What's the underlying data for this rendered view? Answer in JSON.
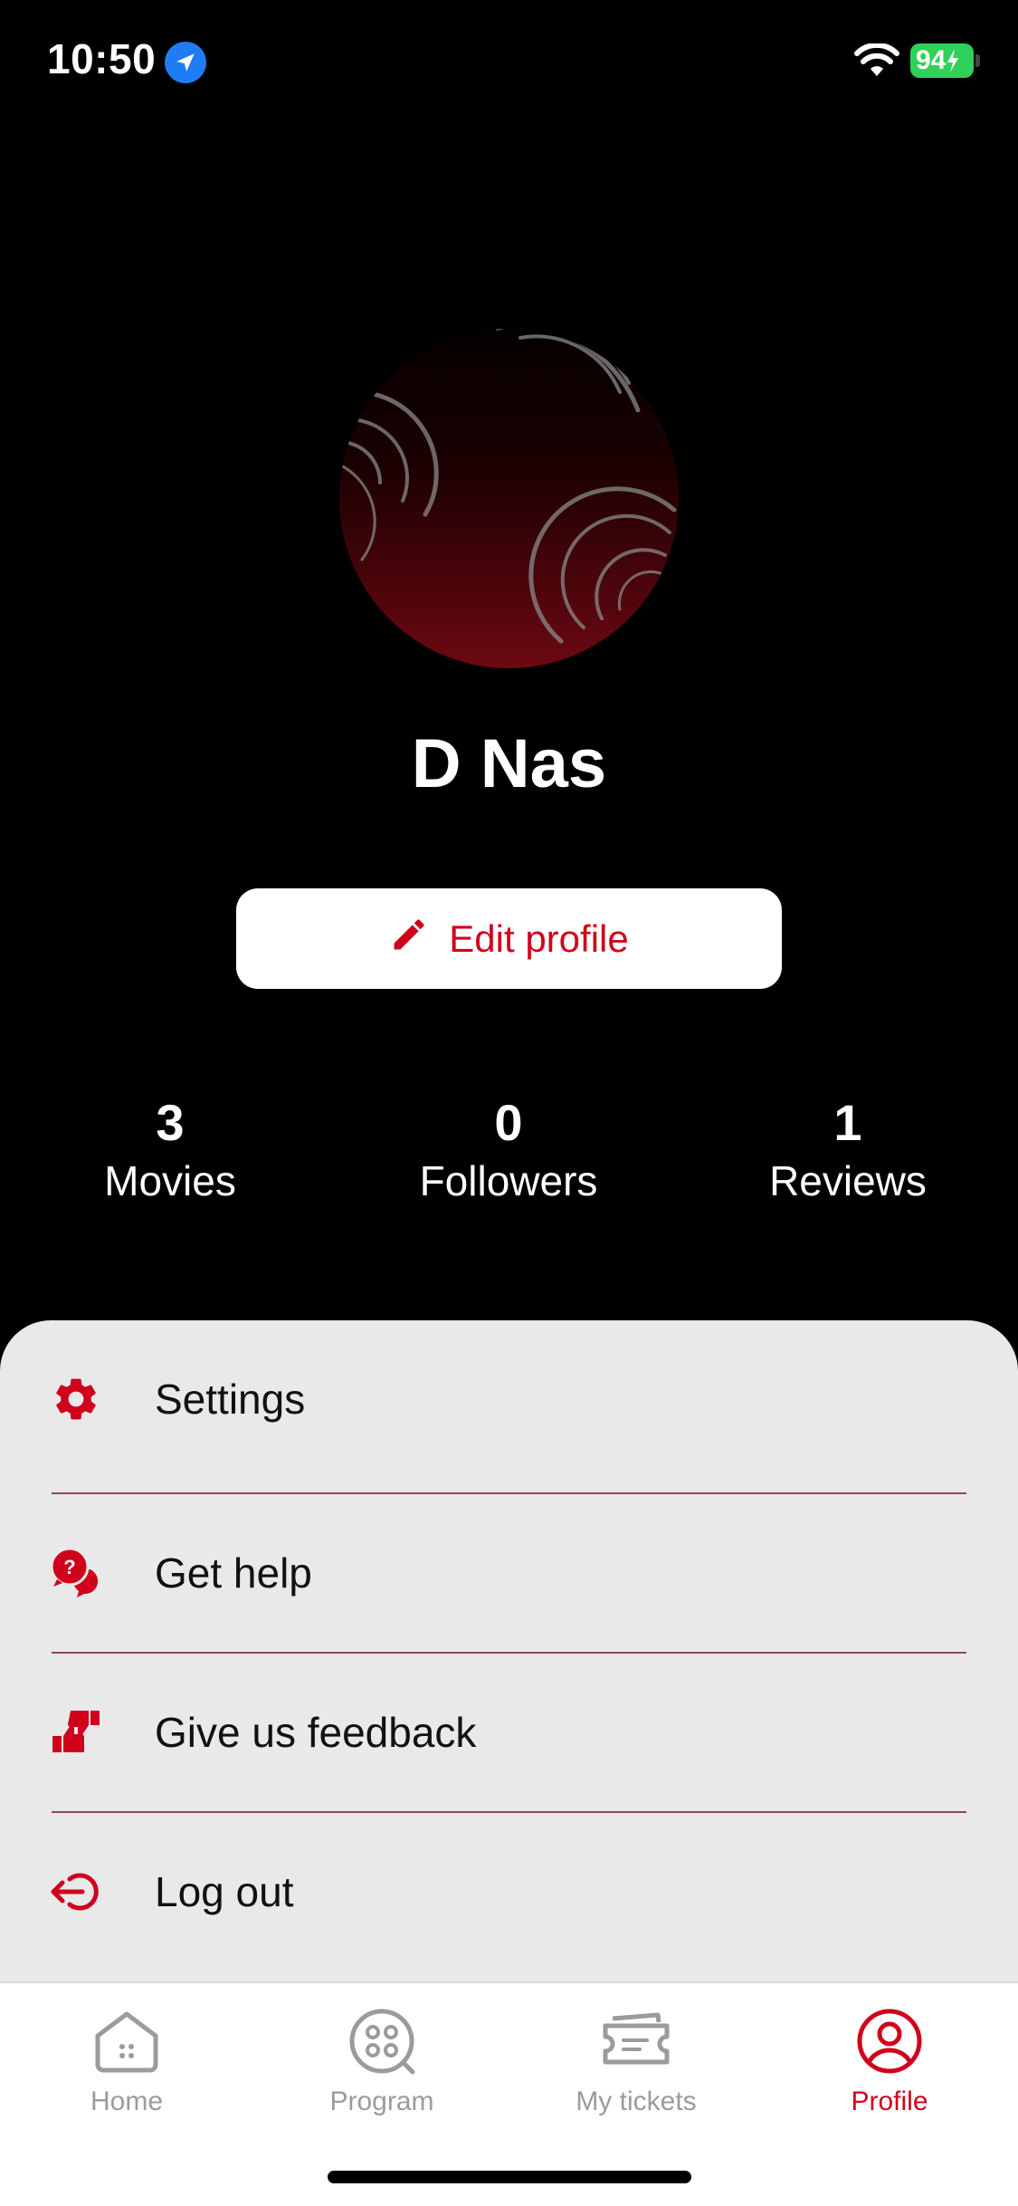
{
  "status_bar": {
    "time": "10:50",
    "battery": "94",
    "icons": [
      "location-arrow-icon",
      "wifi-icon",
      "battery-charging-icon"
    ]
  },
  "profile": {
    "name": "D Nas",
    "edit_label": "Edit profile",
    "stats": [
      {
        "count": "3",
        "label": "Movies"
      },
      {
        "count": "0",
        "label": "Followers"
      },
      {
        "count": "1",
        "label": "Reviews"
      }
    ]
  },
  "menu": {
    "items": [
      {
        "label": "Settings",
        "icon": "gear-icon"
      },
      {
        "label": "Get help",
        "icon": "help-chat-icon"
      },
      {
        "label": "Give us feedback",
        "icon": "thumbs-feedback-icon"
      },
      {
        "label": "Log out",
        "icon": "logout-icon"
      }
    ]
  },
  "tabs": [
    {
      "label": "Home",
      "icon": "home-icon"
    },
    {
      "label": "Program",
      "icon": "film-reel-icon"
    },
    {
      "label": "My tickets",
      "icon": "ticket-icon"
    },
    {
      "label": "Profile",
      "icon": "profile-icon",
      "active": true
    }
  ],
  "colors": {
    "accent": "#d0021b",
    "background": "#000000",
    "sheet": "#e9e9ea",
    "battery": "#30d158",
    "location": "#1f7cf3"
  }
}
